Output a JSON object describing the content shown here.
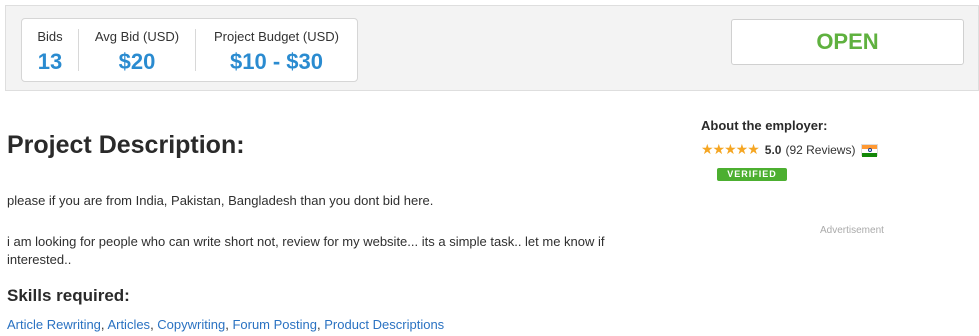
{
  "stats": [
    {
      "label": "Bids",
      "value": "13"
    },
    {
      "label": "Avg Bid (USD)",
      "value": "$20"
    },
    {
      "label": "Project Budget (USD)",
      "value": "$10 - $30"
    }
  ],
  "status": "OPEN",
  "project": {
    "heading": "Project Description:",
    "paragraphs": [
      "please if you are from India, Pakistan, Bangladesh than you dont bid here.",
      "i am looking for people who can write short not, review for my website... its a simple task.. let me know if interested.."
    ]
  },
  "skills": {
    "heading": "Skills required:",
    "items": [
      "Article Rewriting",
      "Articles",
      "Copywriting",
      "Forum Posting",
      "Product Descriptions"
    ]
  },
  "employer": {
    "heading": "About the employer:",
    "stars": "★★★★★",
    "rating": "5.0",
    "reviews": "(92 Reviews)",
    "verified_label": "VERIFIED",
    "flag_colors": {
      "top": "#ff9933",
      "middle": "#ffffff",
      "bottom": "#138808"
    }
  },
  "advertisement_label": "Advertisement",
  "colors": {
    "accent_blue": "#2a8bd0",
    "open_green": "#5fb13f",
    "verified_green": "#4caf30",
    "star_orange": "#f5a623"
  }
}
